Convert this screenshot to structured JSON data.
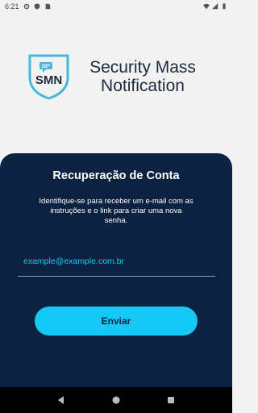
{
  "status": {
    "time": "6:21"
  },
  "brand": {
    "logo_text": "SMN",
    "title_line1": "Security Mass",
    "title_line2": "Notification"
  },
  "recovery": {
    "title": "Recuperação de Conta",
    "description": "Identifique-se para receber um e-mail com as instruções e o link para criar uma nova senha.",
    "email_value": "example@example.com.br",
    "submit_label": "Enviar"
  },
  "colors": {
    "card": "#0c2240",
    "accent": "#16c8f5"
  }
}
